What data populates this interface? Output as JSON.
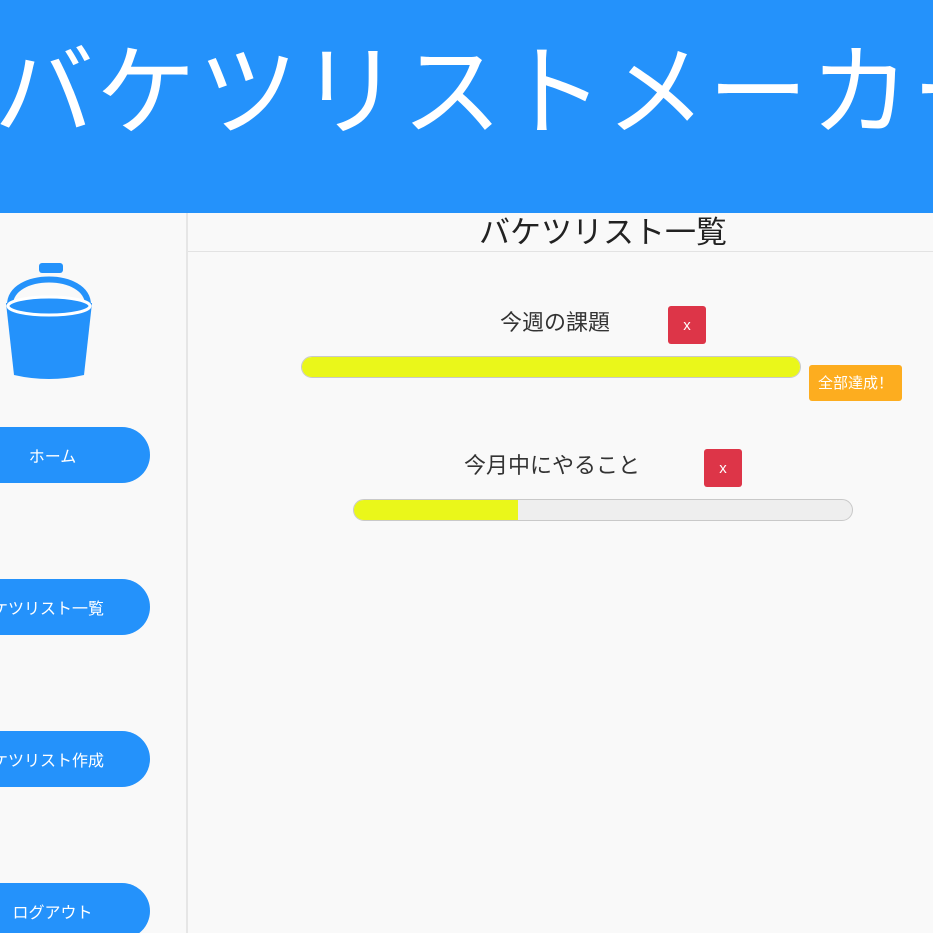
{
  "header": {
    "title": "バケツリストメーカー"
  },
  "sidebar": {
    "logo_icon": "bucket-icon",
    "items": [
      {
        "label": "ホーム"
      },
      {
        "label": "バケツリスト一覧"
      },
      {
        "label": "バケツリスト作成"
      },
      {
        "label": "ログアウト"
      }
    ]
  },
  "main": {
    "title": "バケツリスト一覧",
    "lists": [
      {
        "title": "今週の課題",
        "delete_label": "x",
        "progress": 1.0,
        "complete_label": "全部達成！"
      },
      {
        "title": "今月中にやること",
        "delete_label": "x",
        "progress": 0.33
      }
    ]
  },
  "colors": {
    "brand": "#2492fb",
    "delete": "#dd3548",
    "progress_fill": "#eaf71a",
    "complete_badge": "#fdad1f"
  }
}
